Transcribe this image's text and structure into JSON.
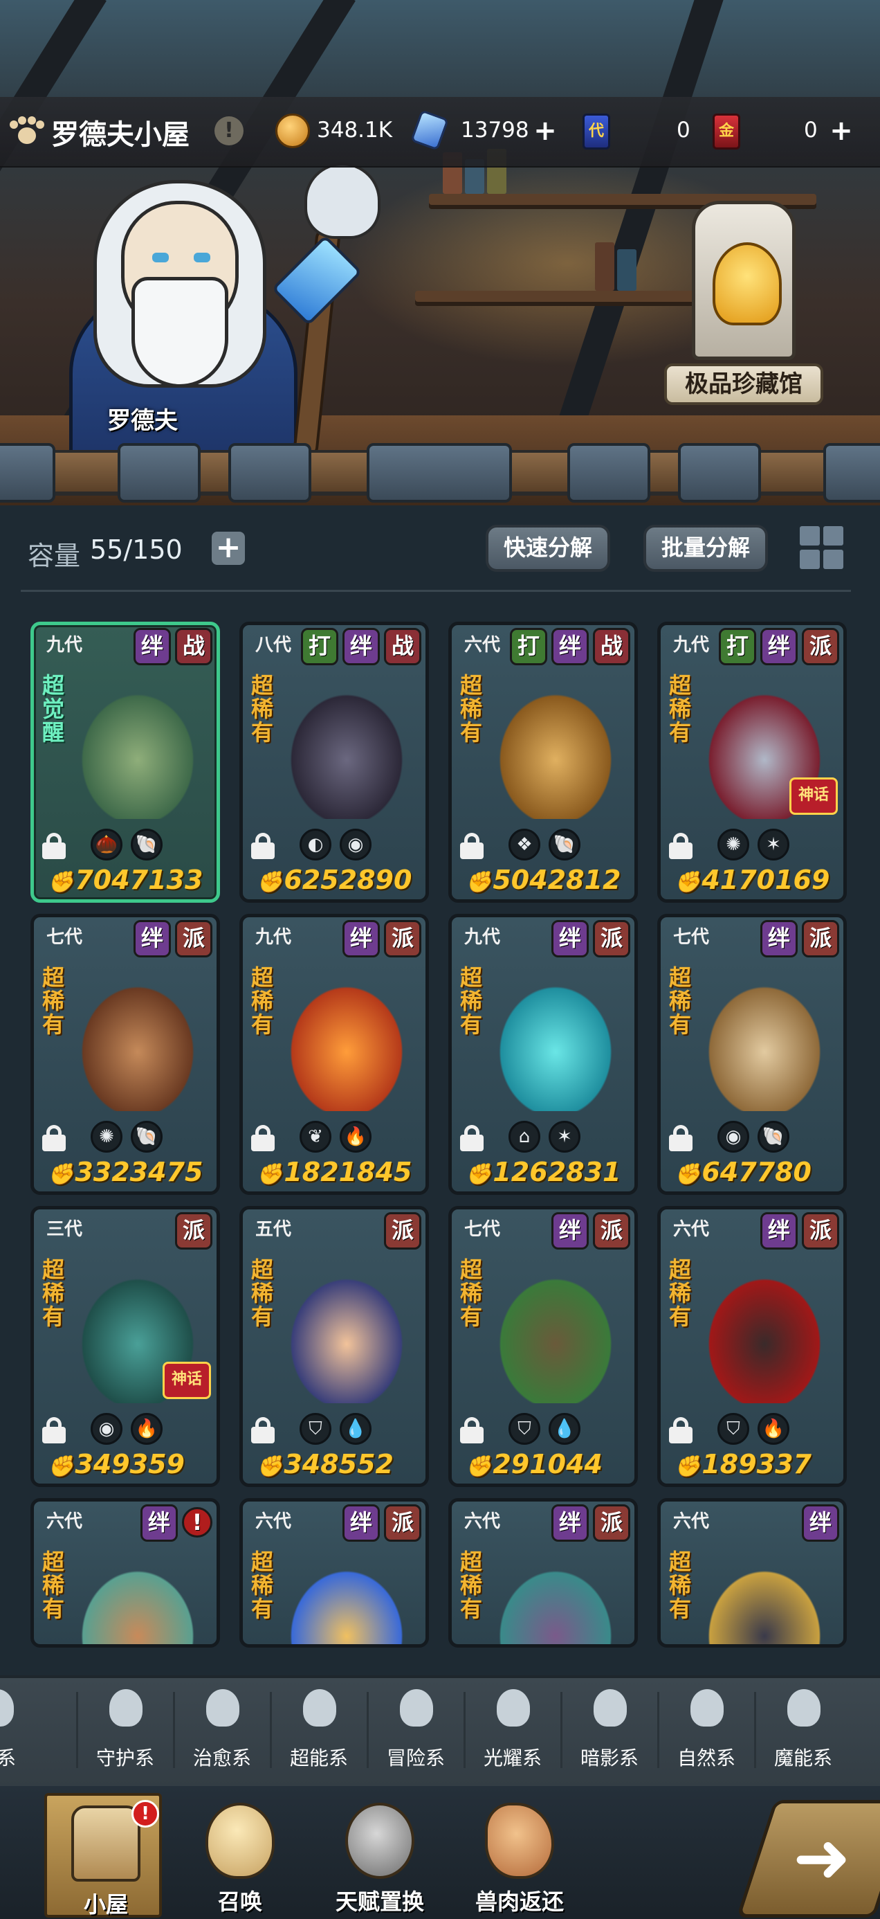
{
  "header": {
    "title": "罗德夫小屋",
    "info_symbol": "!",
    "resources": [
      {
        "icon": "gold-coin-icon",
        "value": "348.1K"
      },
      {
        "icon": "crystal-icon",
        "value": "13798"
      },
      {
        "icon": "blue-ticket-icon",
        "ticket_text": "代",
        "value": "0"
      },
      {
        "icon": "red-ticket-icon",
        "ticket_text": "金",
        "value": "0"
      }
    ],
    "plus": "+"
  },
  "scene": {
    "npc_name": "罗德夫",
    "museum_label": "极品珍藏馆"
  },
  "capacity": {
    "label": "容量",
    "value": "55/150",
    "plus": "+"
  },
  "actions": {
    "quick_decompose": "快速分解",
    "batch_decompose": "批量分解"
  },
  "cards": [
    {
      "gen": "九代",
      "rarity": "超觉醒",
      "tags": [
        "绊",
        "战"
      ],
      "power": "7047133",
      "elements": [
        "🌰",
        "🐚"
      ],
      "awakened": true
    },
    {
      "gen": "八代",
      "rarity": "超稀有",
      "tags": [
        "打",
        "绊",
        "战"
      ],
      "power": "6252890",
      "elements": [
        "◐",
        "◉"
      ]
    },
    {
      "gen": "六代",
      "rarity": "超稀有",
      "tags": [
        "打",
        "绊",
        "战"
      ],
      "power": "5042812",
      "elements": [
        "❖",
        "🐚"
      ]
    },
    {
      "gen": "九代",
      "rarity": "超稀有",
      "tags": [
        "打",
        "绊",
        "派"
      ],
      "power": "4170169",
      "elements": [
        "✺",
        "✶"
      ],
      "badge": "神话"
    },
    {
      "gen": "七代",
      "rarity": "超稀有",
      "tags": [
        "绊",
        "派"
      ],
      "power": "3323475",
      "elements": [
        "✺",
        "🐚"
      ]
    },
    {
      "gen": "九代",
      "rarity": "超稀有",
      "tags": [
        "绊",
        "派"
      ],
      "power": "1821845",
      "elements": [
        "❦",
        "🔥"
      ]
    },
    {
      "gen": "九代",
      "rarity": "超稀有",
      "tags": [
        "绊",
        "派"
      ],
      "power": "1262831",
      "elements": [
        "⌂",
        "✶"
      ]
    },
    {
      "gen": "七代",
      "rarity": "超稀有",
      "tags": [
        "绊",
        "派"
      ],
      "power": "647780",
      "elements": [
        "◉",
        "🐚"
      ]
    },
    {
      "gen": "三代",
      "rarity": "超稀有",
      "tags": [
        "派"
      ],
      "power": "349359",
      "elements": [
        "◉",
        "🔥"
      ],
      "badge": "神话"
    },
    {
      "gen": "五代",
      "rarity": "超稀有",
      "tags": [
        "派"
      ],
      "power": "348552",
      "elements": [
        "⛉",
        "💧"
      ]
    },
    {
      "gen": "七代",
      "rarity": "超稀有",
      "tags": [
        "绊",
        "派"
      ],
      "power": "291044",
      "elements": [
        "⛉",
        "💧"
      ]
    },
    {
      "gen": "六代",
      "rarity": "超稀有",
      "tags": [
        "绊",
        "派"
      ],
      "power": "189337",
      "elements": [
        "⛉",
        "🔥"
      ]
    },
    {
      "gen": "六代",
      "rarity": "超稀有",
      "tags": [
        "绊",
        "!"
      ],
      "power": ""
    },
    {
      "gen": "六代",
      "rarity": "超稀有",
      "tags": [
        "绊",
        "派"
      ],
      "power": ""
    },
    {
      "gen": "六代",
      "rarity": "超稀有",
      "tags": [
        "绊",
        "派"
      ],
      "power": ""
    },
    {
      "gen": "六代",
      "rarity": "超稀有",
      "tags": [
        "绊"
      ],
      "power": ""
    }
  ],
  "categories": [
    "斗系",
    "守护系",
    "治愈系",
    "超能系",
    "冒险系",
    "光耀系",
    "暗影系",
    "自然系",
    "魔能系"
  ],
  "category_first_visible": "斗系",
  "nav": [
    {
      "label": "小屋",
      "badge": "!"
    },
    {
      "label": "召唤"
    },
    {
      "label": "天赋置换"
    },
    {
      "label": "兽肉返还"
    }
  ],
  "colors": {
    "power": "#ffc72c",
    "rarity": "#f3b531",
    "awakened_border": "#3ec98c",
    "tag_bond": "#6e3c8f",
    "tag_battle": "#8a2f36",
    "tag_hit": "#3f7a32",
    "tag_faction": "#8a3a34"
  }
}
